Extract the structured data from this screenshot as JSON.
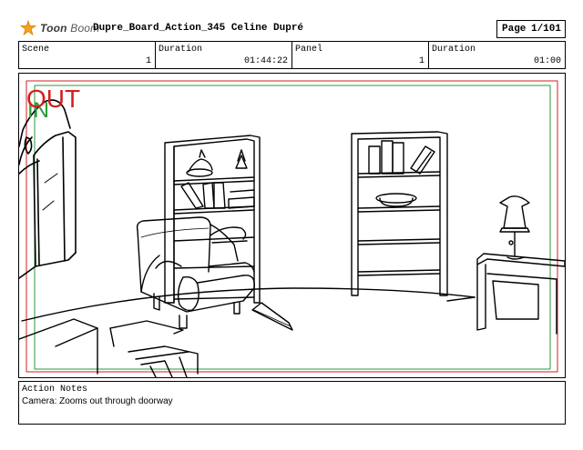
{
  "header": {
    "logo_text_1": "Toon",
    "logo_text_2": "Boom",
    "title": "Dupre_Board_Action_345  Celine Dupré",
    "page_label": "Page",
    "page_value": "1/101"
  },
  "info": {
    "scene_label": "Scene",
    "scene_value": "1",
    "duration1_label": "Duration",
    "duration1_value": "01:44:22",
    "panel_label": "Panel",
    "panel_value": "1",
    "duration2_label": "Duration",
    "duration2_value": "01:00"
  },
  "panel": {
    "out_label": "OUT",
    "in_label": "IN",
    "out_color": "#d21f1f",
    "in_color": "#2a9a3a"
  },
  "notes": {
    "label": "Action Notes",
    "text": "Camera: Zooms out through doorway"
  },
  "icons": [
    "toon-boom-logo-icon"
  ]
}
